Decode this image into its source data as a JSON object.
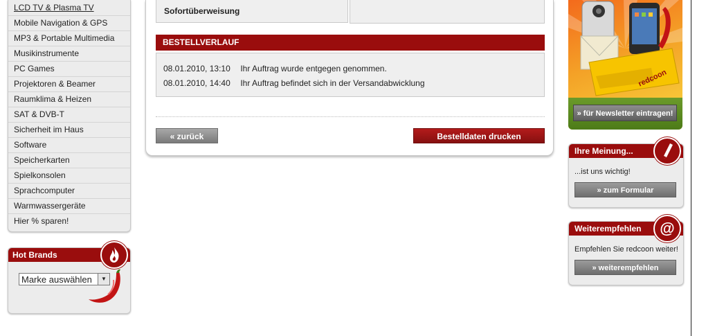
{
  "categories": [
    "LCD TV & Plasma TV",
    "Mobile Navigation & GPS",
    "MP3 & Portable Multimedia",
    "Musikinstrumente",
    "PC Games",
    "Projektoren & Beamer",
    "Raumklima & Heizen",
    "SAT & DVB-T",
    "Sicherheit im Haus",
    "Software",
    "Speicherkarten",
    "Spielkonsolen",
    "Sprachcomputer",
    "Warmwassergeräte",
    "Hier % sparen!"
  ],
  "hot_brands": {
    "title": "Hot Brands",
    "select_value": "Marke auswählen"
  },
  "payment": {
    "method": "Sofortüberweisung",
    "value": ""
  },
  "history": {
    "title": "BESTELLVERLAUF",
    "entries": [
      {
        "date": "08.01.2010, 13:10",
        "text": "Ihr Auftrag wurde entgegen genommen."
      },
      {
        "date": "08.01.2010, 14:40",
        "text": "Ihr Auftrag befindet sich in der Versandabwicklung"
      }
    ]
  },
  "buttons": {
    "back": "« zurück",
    "print": "Bestelldaten drucken"
  },
  "promo": {
    "logo": "redcoon",
    "newsletter_button": "» für Newsletter eintragen!"
  },
  "meinung": {
    "title": "Ihre Meinung...",
    "text": "...ist uns wichtig!",
    "button": "» zum Formular"
  },
  "weiter": {
    "title": "Weiterempfehlen",
    "text": "Empfehlen Sie redcoon weiter!",
    "button": "» weiterempfehlen"
  },
  "colors": {
    "brand_red": "#9a0d0d",
    "panel_grey": "#ececec",
    "promo_green": "#5a8a20"
  }
}
